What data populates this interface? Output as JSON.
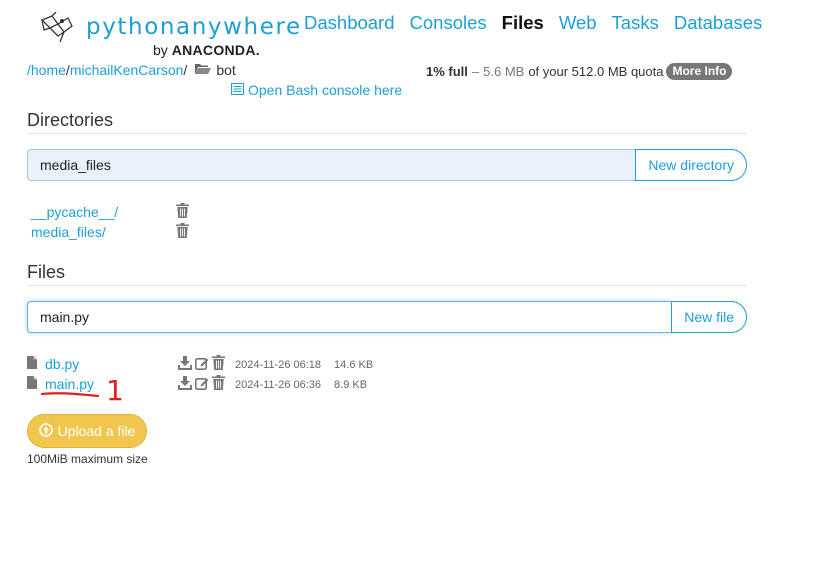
{
  "header": {
    "logo_text": "pythonanywhere",
    "logo_by": "by",
    "logo_brand": "ANACONDA.",
    "nav": [
      {
        "label": "Dashboard",
        "active": false
      },
      {
        "label": "Consoles",
        "active": false
      },
      {
        "label": "Files",
        "active": true
      },
      {
        "label": "Web",
        "active": false
      },
      {
        "label": "Tasks",
        "active": false
      },
      {
        "label": "Databases",
        "active": false
      }
    ]
  },
  "breadcrumb": {
    "root": "/home",
    "sep1": "/",
    "user": "michailKenCarson",
    "sep2": "/",
    "current": "bot"
  },
  "bash_link": "Open Bash console here",
  "quota": {
    "percent": "1% full",
    "dash": "–",
    "used": "5.6 MB",
    "rest": "of your 512.0 MB quota",
    "more_info": "More Info"
  },
  "directories": {
    "title": "Directories",
    "input_value": "media_files",
    "new_button": "New directory",
    "items": [
      {
        "name": "__pycache__/"
      },
      {
        "name": "media_files/"
      }
    ]
  },
  "files": {
    "title": "Files",
    "input_value": "main.py",
    "new_button": "New file",
    "items": [
      {
        "name": "db.py",
        "modified": "2024-11-26 06:18",
        "size": "14.6 KB"
      },
      {
        "name": "main.py",
        "modified": "2024-11-26 06:36",
        "size": "8.9 KB"
      }
    ]
  },
  "upload": {
    "label": "Upload a file",
    "max_size": "100MiB maximum size"
  },
  "annotation": {
    "number": "1",
    "color": "#e02020"
  },
  "colors": {
    "accent": "#1d9fd6",
    "upload": "#f0c64f"
  }
}
